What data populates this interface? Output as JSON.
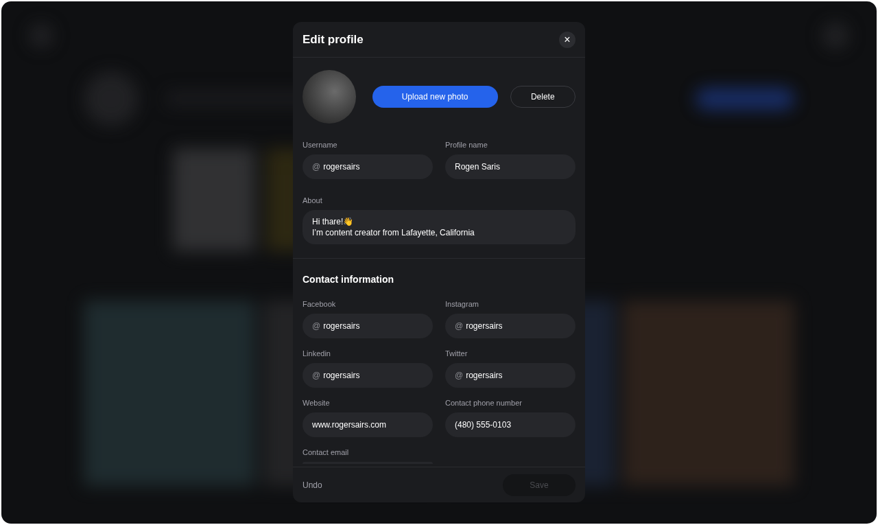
{
  "dialog": {
    "title": "Edit profile",
    "close_icon": "×"
  },
  "photo": {
    "upload_button": "Upload new photo",
    "delete_button": "Delete"
  },
  "profile_fields": [
    {
      "label": "Username",
      "prefix": "@",
      "value": "rogersairs"
    },
    {
      "label": "Profile name",
      "value": "Rogen Saris"
    }
  ],
  "about": {
    "label": "About",
    "lines": [
      "Hi thare!👋",
      "I’m content creator from Lafayette, California"
    ]
  },
  "contact": {
    "heading": "Contact information",
    "fields": [
      {
        "label": "Facebook",
        "prefix": "@",
        "value": "rogersairs"
      },
      {
        "label": "Instagram",
        "prefix": "@",
        "value": "rogersairs"
      },
      {
        "label": "Linkedin",
        "prefix": "@",
        "value": "rogersairs"
      },
      {
        "label": "Twitter",
        "prefix": "@",
        "value": "rogersairs"
      },
      {
        "label": "Website",
        "value": "www.rogersairs.com"
      },
      {
        "label": "Contact phone number",
        "value": "(480) 555-0103"
      },
      {
        "label": "Contact email"
      }
    ]
  },
  "footer": {
    "undo": "Undo",
    "save": {
      "label": "Save",
      "disabled": true
    }
  }
}
